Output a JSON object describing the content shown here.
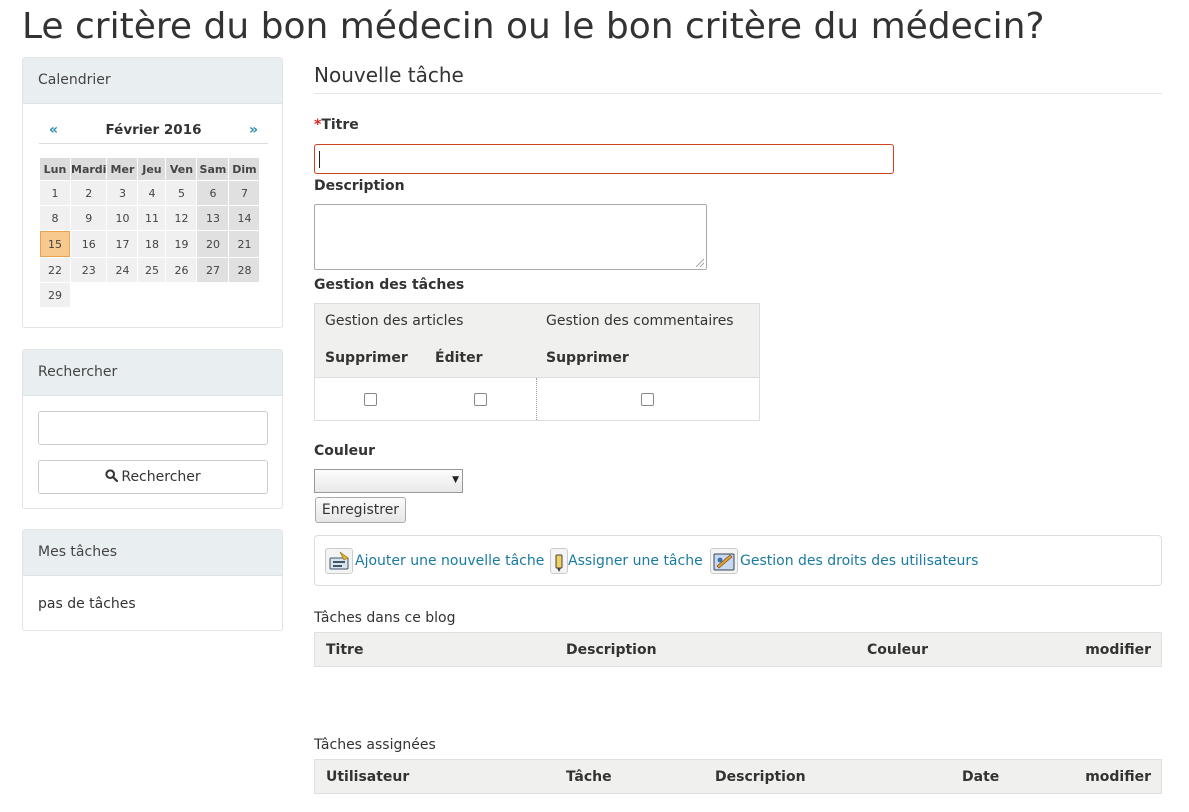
{
  "page": {
    "title": "Le critère du bon médecin ou le bon critère du médecin?"
  },
  "calendar": {
    "heading": "Calendrier",
    "prev": "«",
    "next": "»",
    "month": "Février 2016",
    "days": [
      "Lun",
      "Mardi",
      "Mer",
      "Jeu",
      "Ven",
      "Sam",
      "Dim"
    ],
    "weeks": [
      [
        "1",
        "2",
        "3",
        "4",
        "5",
        "6",
        "7"
      ],
      [
        "8",
        "9",
        "10",
        "11",
        "12",
        "13",
        "14"
      ],
      [
        "15",
        "16",
        "17",
        "18",
        "19",
        "20",
        "21"
      ],
      [
        "22",
        "23",
        "24",
        "25",
        "26",
        "27",
        "28"
      ],
      [
        "29",
        "",
        "",
        "",
        "",
        "",
        ""
      ]
    ],
    "today": "15"
  },
  "search": {
    "heading": "Rechercher",
    "button": "Rechercher",
    "placeholder": ""
  },
  "my_tasks": {
    "heading": "Mes tâches",
    "empty": "pas de tâches"
  },
  "form": {
    "section_title": "Nouvelle tâche",
    "required_mark": "*",
    "title_label": "Titre",
    "description_label": "Description",
    "management_label": "Gestion des tâches",
    "permissions": {
      "group1": "Gestion des articles",
      "group2": "Gestion des commentaires",
      "col1": "Supprimer",
      "col2": "Éditer",
      "col3": "Supprimer"
    },
    "color_label": "Couleur",
    "color_value": "",
    "save_button": "Enregistrer"
  },
  "actions": {
    "add_task": "Ajouter une nouvelle tâche",
    "assign_task": "Assigner une tâche",
    "manage_rights": "Gestion des droits des utilisateurs"
  },
  "blog_tasks": {
    "label": "Tâches dans ce blog",
    "columns": {
      "title": "Titre",
      "description": "Description",
      "color": "Couleur",
      "edit": "modifier"
    }
  },
  "assigned_tasks": {
    "label": "Tâches assignées",
    "columns": {
      "user": "Utilisateur",
      "task": "Tâche",
      "description": "Description",
      "date": "Date",
      "edit": "modifier"
    }
  }
}
